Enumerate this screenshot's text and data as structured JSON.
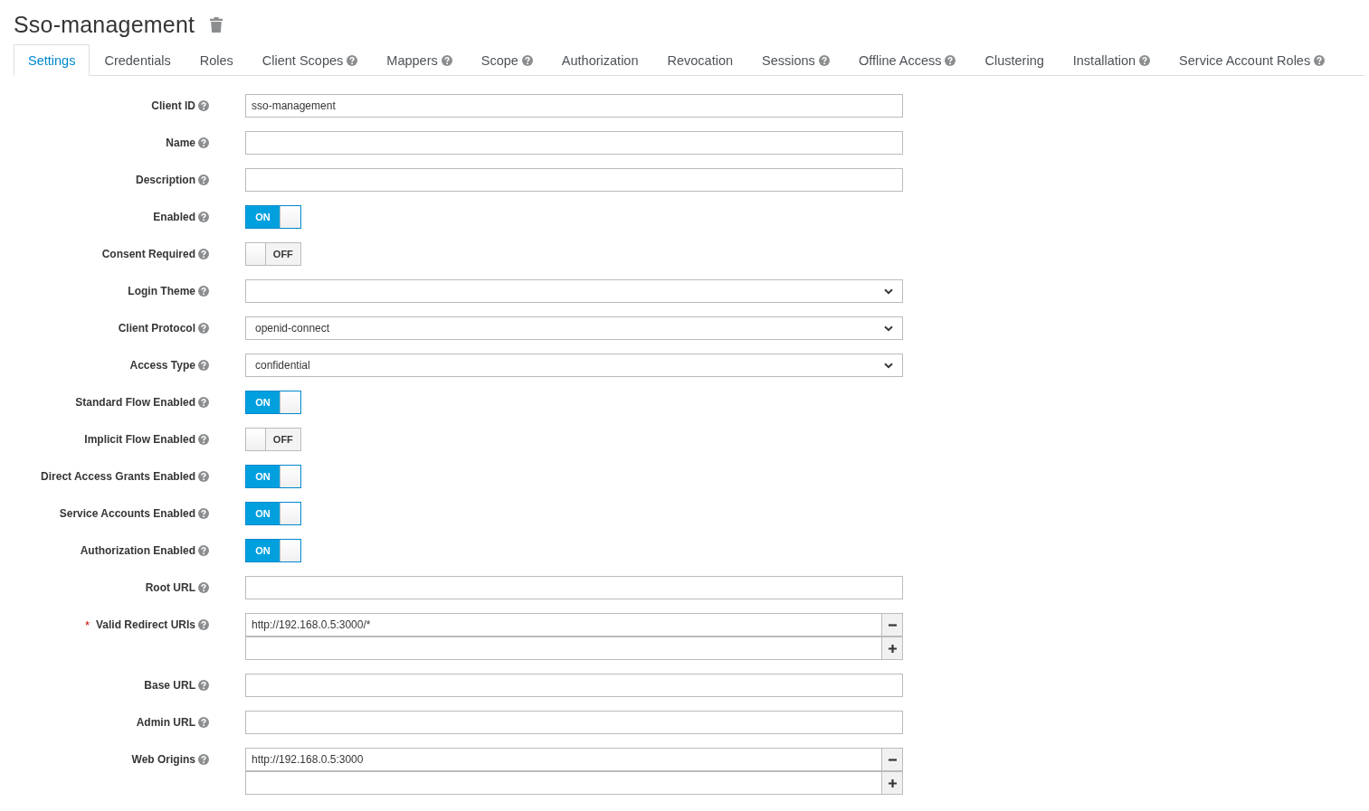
{
  "header": {
    "title": "Sso-management"
  },
  "tabs": [
    {
      "label": "Settings",
      "help": false,
      "selected": true
    },
    {
      "label": "Credentials",
      "help": false,
      "selected": false
    },
    {
      "label": "Roles",
      "help": false,
      "selected": false
    },
    {
      "label": "Client Scopes",
      "help": true,
      "selected": false
    },
    {
      "label": "Mappers",
      "help": true,
      "selected": false
    },
    {
      "label": "Scope",
      "help": true,
      "selected": false
    },
    {
      "label": "Authorization",
      "help": false,
      "selected": false
    },
    {
      "label": "Revocation",
      "help": false,
      "selected": false
    },
    {
      "label": "Sessions",
      "help": true,
      "selected": false
    },
    {
      "label": "Offline Access",
      "help": true,
      "selected": false
    },
    {
      "label": "Clustering",
      "help": false,
      "selected": false
    },
    {
      "label": "Installation",
      "help": true,
      "selected": false
    },
    {
      "label": "Service Account Roles",
      "help": true,
      "selected": false
    }
  ],
  "fields": [
    {
      "kind": "text",
      "label": "Client ID",
      "help": true,
      "value": "sso-management"
    },
    {
      "kind": "text",
      "label": "Name",
      "help": true
    },
    {
      "kind": "text",
      "label": "Description",
      "help": true
    },
    {
      "kind": "toggle",
      "label": "Enabled",
      "help": true,
      "on": true,
      "state_text": "ON"
    },
    {
      "kind": "toggle",
      "label": "Consent Required",
      "help": true,
      "on": false,
      "state_text": "OFF"
    },
    {
      "kind": "select",
      "label": "Login Theme",
      "help": true
    },
    {
      "kind": "select",
      "label": "Client Protocol",
      "help": true,
      "value": "openid-connect"
    },
    {
      "kind": "select",
      "label": "Access Type",
      "help": true,
      "value": "confidential"
    },
    {
      "kind": "toggle",
      "label": "Standard Flow Enabled",
      "help": true,
      "on": true,
      "state_text": "ON"
    },
    {
      "kind": "toggle",
      "label": "Implicit Flow Enabled",
      "help": true,
      "on": false,
      "state_text": "OFF"
    },
    {
      "kind": "toggle",
      "label": "Direct Access Grants Enabled",
      "help": true,
      "on": true,
      "state_text": "ON"
    },
    {
      "kind": "toggle",
      "label": "Service Accounts Enabled",
      "help": true,
      "on": true,
      "state_text": "ON"
    },
    {
      "kind": "toggle",
      "label": "Authorization Enabled",
      "help": true,
      "on": true,
      "state_text": "ON"
    },
    {
      "kind": "text",
      "label": "Root URL",
      "help": true
    },
    {
      "kind": "multi",
      "label": "Valid Redirect URIs",
      "help": true,
      "required_mark": "*",
      "entries": [
        {
          "kind": "remove",
          "value": "http://192.168.0.5:3000/*"
        },
        {
          "kind": "add"
        }
      ]
    },
    {
      "kind": "text",
      "label": "Base URL",
      "help": true
    },
    {
      "kind": "text",
      "label": "Admin URL",
      "help": true
    },
    {
      "kind": "multi",
      "label": "Web Origins",
      "help": true,
      "entries": [
        {
          "kind": "remove",
          "value": "http://192.168.0.5:3000"
        },
        {
          "kind": "add"
        }
      ]
    }
  ]
}
